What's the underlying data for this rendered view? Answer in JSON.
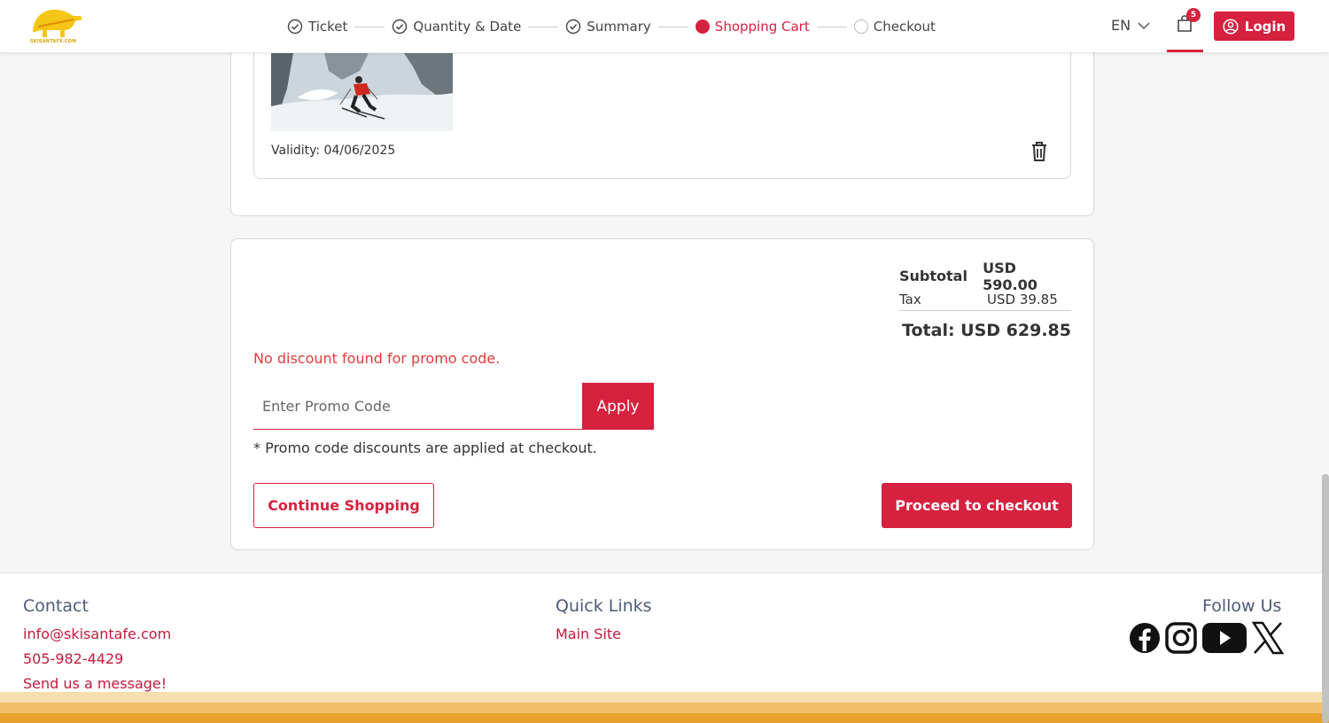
{
  "brand": {
    "logo_text": "SKISANTAFE.COM",
    "accent": "#d6213f",
    "logo_color": "#f5c518"
  },
  "steps": [
    {
      "label": "Ticket",
      "state": "done"
    },
    {
      "label": "Quantity & Date",
      "state": "done"
    },
    {
      "label": "Summary",
      "state": "done"
    },
    {
      "label": "Shopping Cart",
      "state": "active"
    },
    {
      "label": "Checkout",
      "state": "pending"
    }
  ],
  "header": {
    "language": "EN",
    "cart_count": "5",
    "login_label": "Login"
  },
  "cart_item": {
    "validity": "Validity: 04/06/2025",
    "delete_icon": "trash-icon"
  },
  "summary": {
    "subtotal_label": "Subtotal",
    "subtotal_value": "USD 590.00",
    "tax_label": "Tax",
    "tax_value": "USD 39.85",
    "total": "Total: USD 629.85",
    "promo_error": "No discount found for promo code.",
    "promo_placeholder": "Enter Promo Code",
    "apply_label": "Apply",
    "promo_note": "* Promo code discounts are applied at checkout.",
    "continue_label": "Continue Shopping",
    "checkout_label": "Proceed to checkout"
  },
  "footer": {
    "contact_heading": "Contact",
    "email": "info@skisantafe.com",
    "phone": "505-982-4429",
    "message": "Send us a message!",
    "quick_links_heading": "Quick Links",
    "main_site": "Main Site",
    "follow_heading": "Follow Us",
    "social_icons": [
      "facebook-icon",
      "instagram-icon",
      "youtube-icon",
      "x-icon"
    ]
  }
}
